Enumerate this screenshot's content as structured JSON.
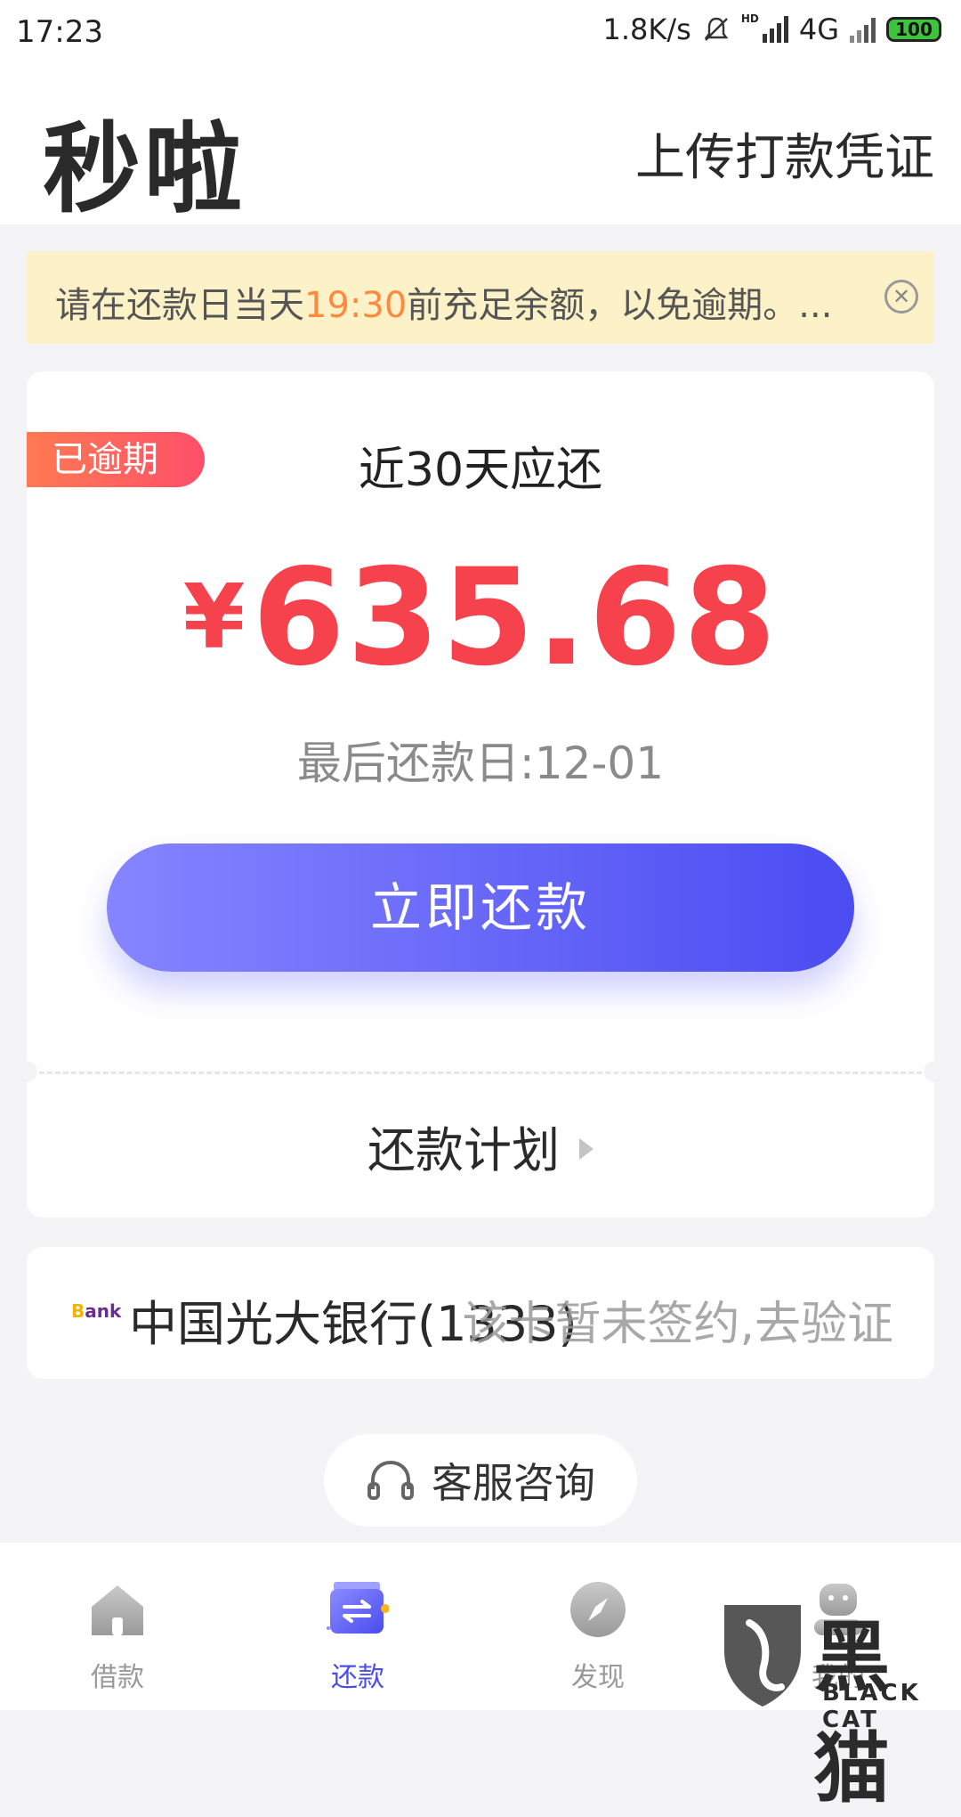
{
  "status_bar": {
    "time": "17:23",
    "net_speed": "1.8K/s",
    "hd_label": "HD",
    "network": "4G",
    "battery": "100"
  },
  "header": {
    "app_title": "秒啦",
    "upload_label": "上传打款凭证"
  },
  "notice": {
    "text_before": "请在还款日当天",
    "highlight": "19:30",
    "text_after": "前充足余额，以免逾期。...",
    "highlight_color": "#ff8a3d"
  },
  "repayment": {
    "badge": "已逾期",
    "subtitle": "近30天应还",
    "currency": "¥",
    "amount": "635.68",
    "due_date": "最后还款日:12-01",
    "pay_button": "立即还款",
    "plan_link": "还款计划",
    "amount_color": "#f5424c"
  },
  "bank": {
    "icon_text_a": "B",
    "icon_text_b": "ank",
    "name": "中国光大银行(1333)",
    "status": "该卡暂未签约,去验证"
  },
  "service": {
    "label": "客服咨询"
  },
  "tabs": [
    {
      "label": "借款",
      "icon": "home-icon"
    },
    {
      "label": "还款",
      "icon": "repay-icon"
    },
    {
      "label": "发现",
      "icon": "compass-icon"
    },
    {
      "label": "我的",
      "icon": "profile-icon"
    }
  ],
  "watermark": {
    "cn": "黑猫",
    "en": "BLACK CAT"
  },
  "colors": {
    "accent": "#4a4cf0",
    "badge_gradient_start": "#ff7a52",
    "badge_gradient_end": "#ff4f6a"
  }
}
